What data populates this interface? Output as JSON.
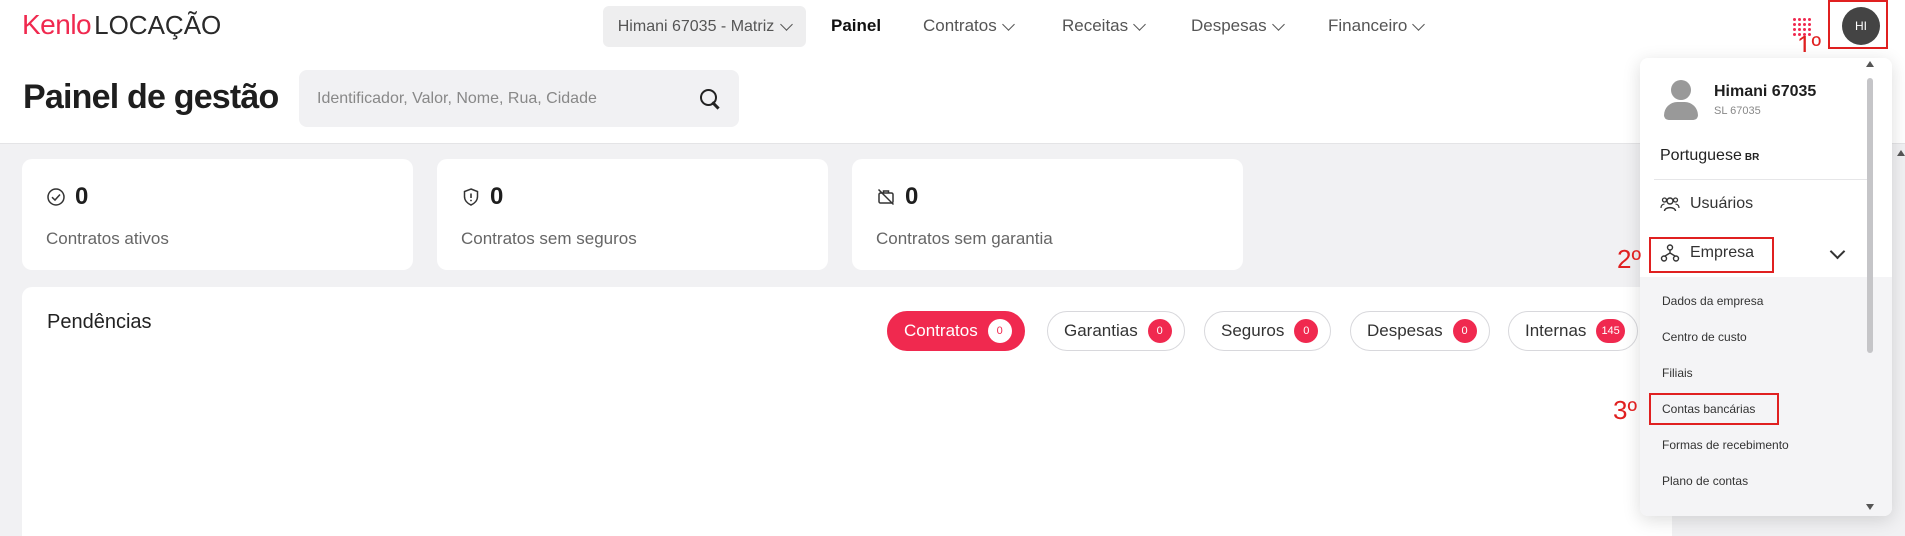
{
  "logo": {
    "brand": "Kenlo",
    "product": "LOCAÇÃO"
  },
  "nav": {
    "company_select": "Himani 67035 - Matriz",
    "items": [
      "Painel",
      "Contratos",
      "Receitas",
      "Despesas",
      "Financeiro"
    ]
  },
  "user": {
    "initials": "HI"
  },
  "header": {
    "title": "Painel de gestão",
    "search_placeholder": "Identificador, Valor, Nome, Rua, Cidade"
  },
  "stats": [
    {
      "value": "0",
      "label": "Contratos ativos",
      "icon": "check-circle-icon"
    },
    {
      "value": "0",
      "label": "Contratos sem seguros",
      "icon": "shield-icon"
    },
    {
      "value": "0",
      "label": "Contratos sem garantia",
      "icon": "no-guarantee-icon"
    }
  ],
  "pendencias": {
    "title": "Pendências",
    "tabs": [
      {
        "label": "Contratos",
        "count": "0"
      },
      {
        "label": "Garantias",
        "count": "0"
      },
      {
        "label": "Seguros",
        "count": "0"
      },
      {
        "label": "Despesas",
        "count": "0"
      },
      {
        "label": "Internas",
        "count": "145"
      }
    ]
  },
  "dropdown": {
    "name": "Himani 67035",
    "sub": "SL 67035",
    "language": "Portuguese",
    "language_code": "BR",
    "users": "Usuários",
    "company": "Empresa",
    "company_items": [
      "Dados da empresa",
      "Centro de custo",
      "Filiais",
      "Contas bancárias",
      "Formas de recebimento",
      "Plano de contas"
    ]
  },
  "steps": [
    "1º",
    "2º",
    "3º"
  ],
  "colors": {
    "accent": "#f0294f",
    "annotation": "#e02020"
  }
}
